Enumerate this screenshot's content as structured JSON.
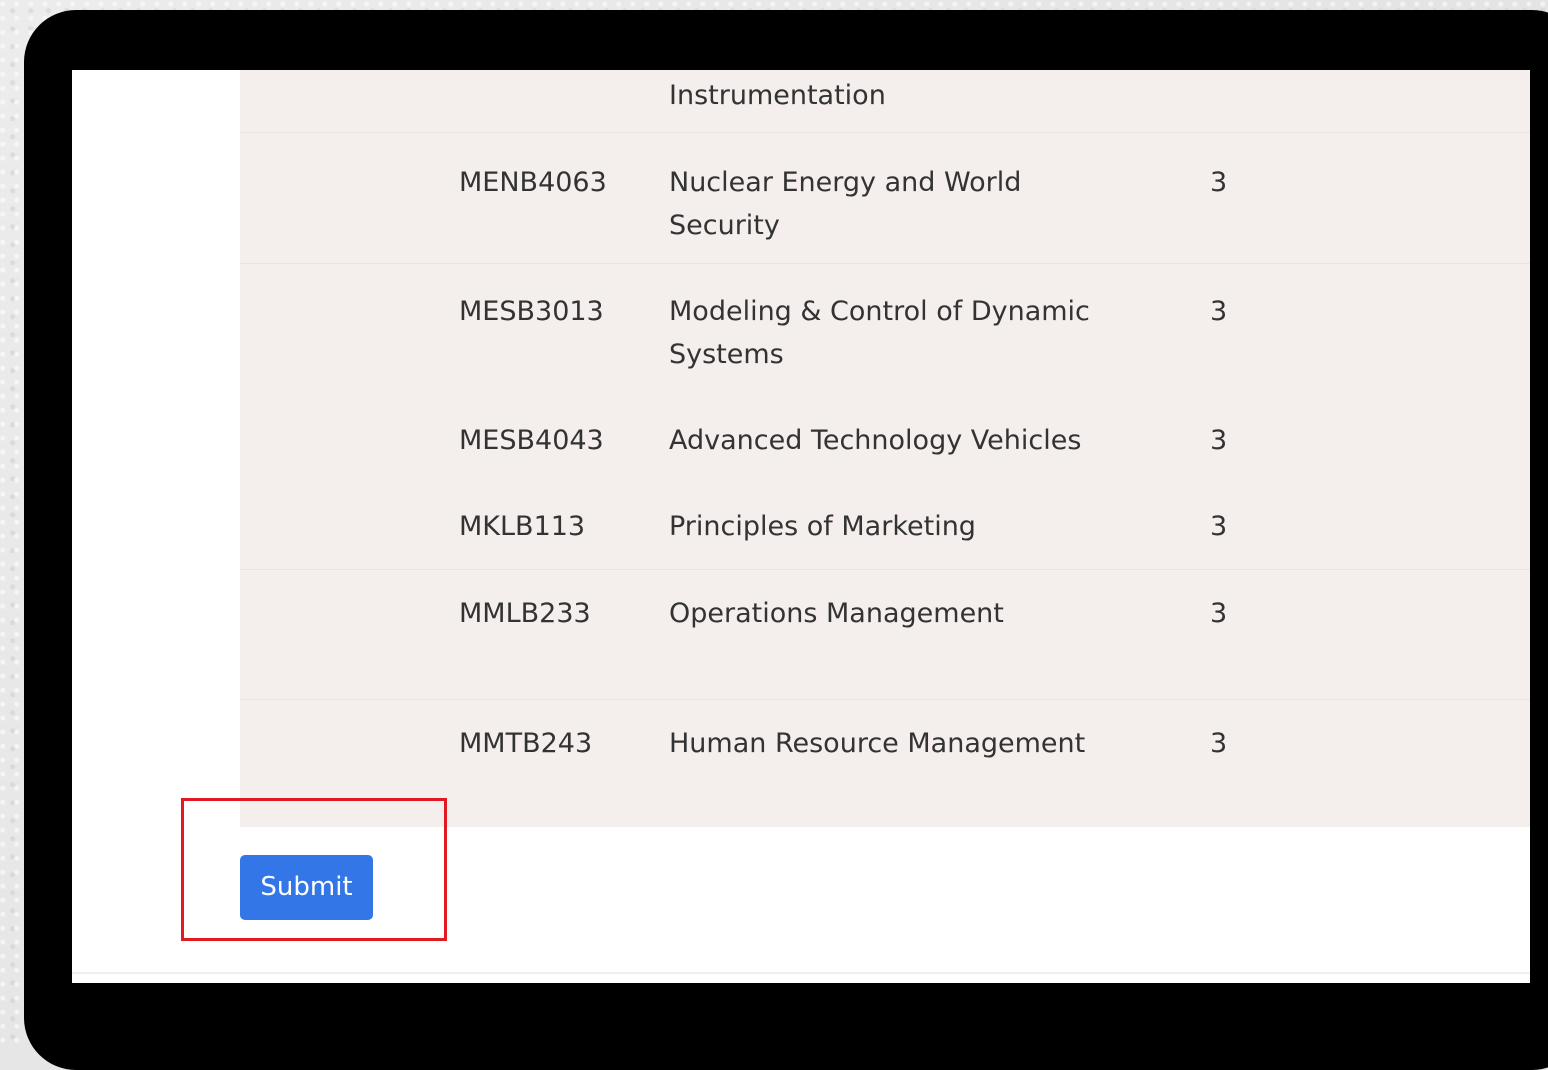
{
  "courses": [
    {
      "code": "",
      "name": "Instrumentation",
      "credits": ""
    },
    {
      "code": "MENB4063",
      "name": "Nuclear Energy and World Security",
      "credits": "3"
    },
    {
      "code": "MESB3013",
      "name": "Modeling & Control of Dynamic Systems",
      "credits": "3"
    },
    {
      "code": "MESB4043",
      "name": "Advanced Technology Vehicles",
      "credits": "3"
    },
    {
      "code": "MKLB113",
      "name": "Principles of Marketing",
      "credits": "3"
    },
    {
      "code": "MMLB233",
      "name": "Operations Management",
      "credits": "3"
    },
    {
      "code": "MMTB243",
      "name": "Human Resource Management",
      "credits": "3"
    }
  ],
  "submit": {
    "label": "Submit"
  },
  "colors": {
    "table_background": "#f4eeec",
    "button": "#3276e8",
    "highlight": "#e01a20"
  }
}
